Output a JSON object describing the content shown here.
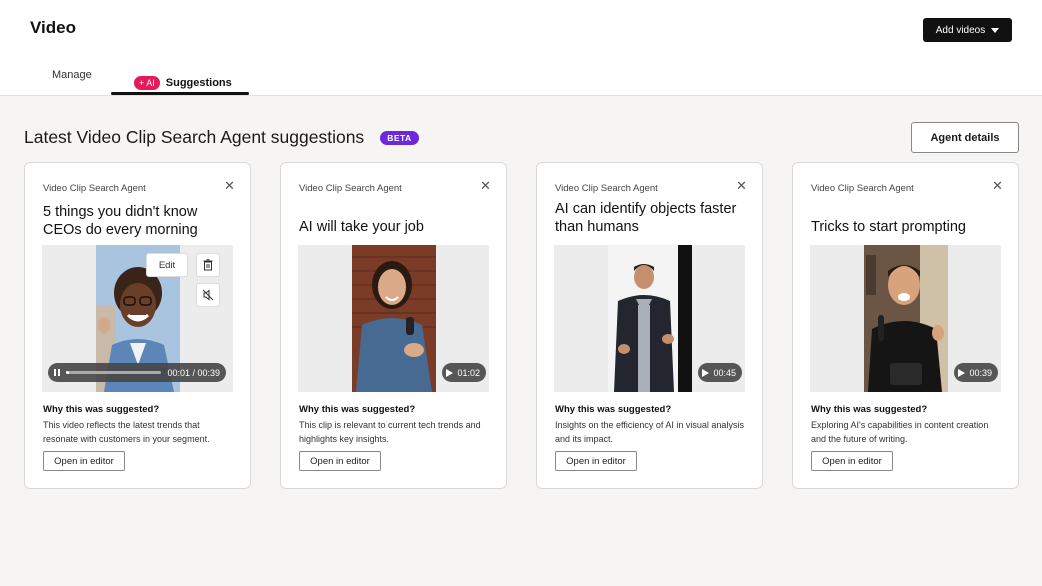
{
  "header": {
    "title": "Video",
    "add_button": "Add videos",
    "tabs": [
      {
        "label": "Manage"
      },
      {
        "label": "Suggestions",
        "badge": "+ AI"
      }
    ]
  },
  "section": {
    "title": "Latest Video Clip Search Agent suggestions",
    "badge": "BETA",
    "agent_button": "Agent details"
  },
  "colors": {
    "ai_badge": "#e8195b",
    "beta_badge": "#6d28d9",
    "primary_button": "#111111"
  },
  "cards": [
    {
      "agent": "Video Clip Search Agent",
      "title": "5 things you didn't know CEOs do every morning",
      "player": {
        "time": "00:01 / 00:39",
        "progress": 0.03,
        "edit_label": "Edit"
      },
      "why_label": "Why this was suggested?",
      "why_text": "This video reflects the latest trends that resonate with customers in your segment.",
      "open_label": "Open in editor"
    },
    {
      "agent": "Video Clip Search Agent",
      "title": "AI will take your job",
      "duration": "01:02",
      "why_label": "Why this was suggested?",
      "why_text": "This clip is relevant to current tech trends and highlights key insights.",
      "open_label": "Open in editor"
    },
    {
      "agent": "Video Clip Search Agent",
      "title": "AI can identify objects faster than humans",
      "duration": "00:45",
      "why_label": "Why this was suggested?",
      "why_text": "Insights on the efficiency of AI in visual analysis and its impact.",
      "open_label": "Open in editor"
    },
    {
      "agent": "Video Clip Search Agent",
      "title": "Tricks to start prompting",
      "duration": "00:39",
      "why_label": "Why this was suggested?",
      "why_text": "Exploring AI's capabilities in content creation and the future of writing.",
      "open_label": "Open in editor"
    }
  ]
}
